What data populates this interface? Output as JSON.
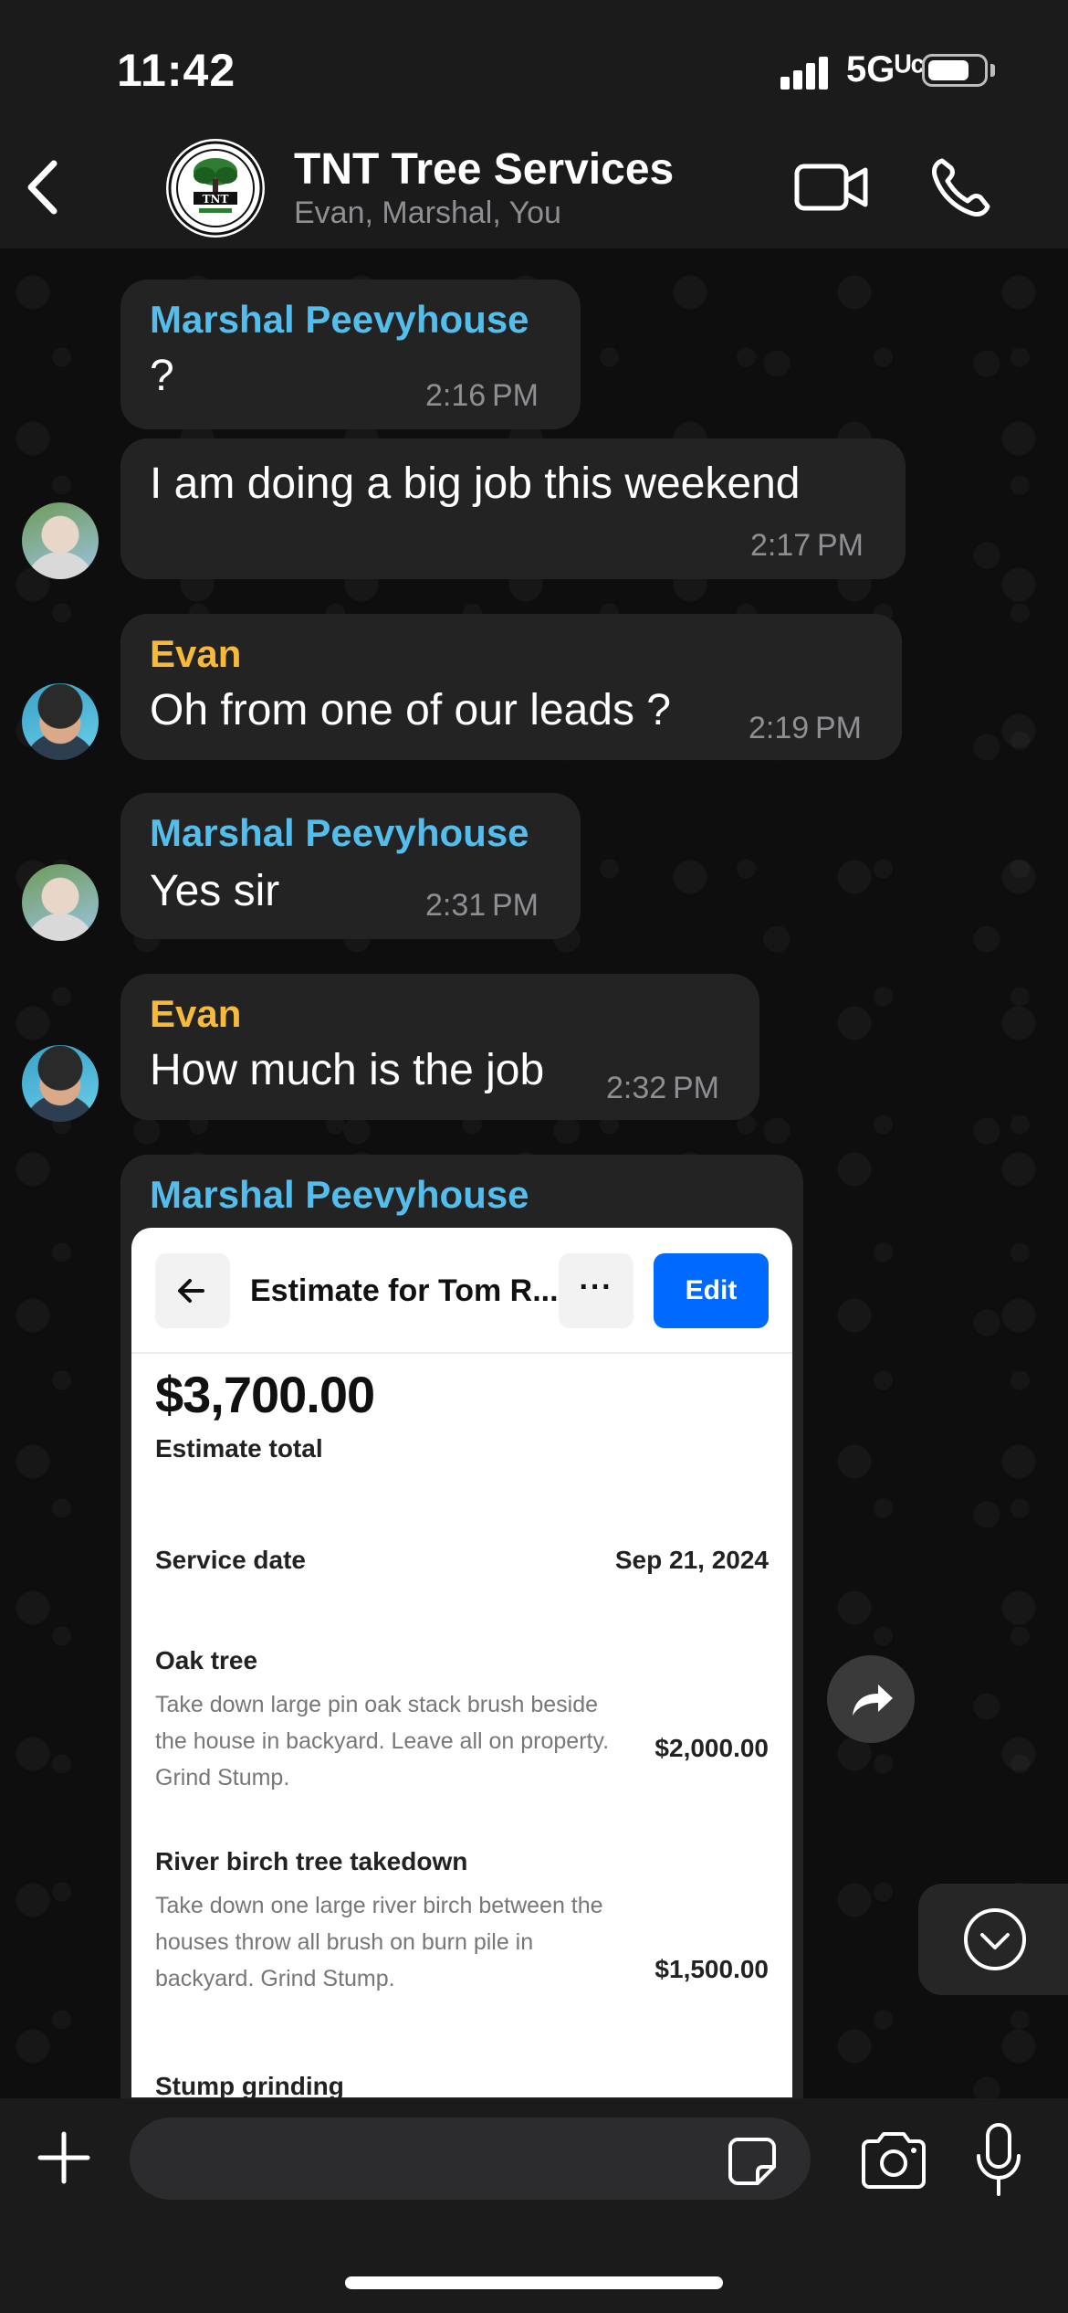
{
  "status_bar": {
    "time": "11:42",
    "network": "5Gᵁᶜ",
    "battery_level": 0.75
  },
  "header": {
    "back_icon": "chevron-left-icon",
    "title": "TNT Tree Services",
    "subtitle": "Evan, Marshal, You",
    "avatar_logo_text": "TNT",
    "video_icon": "video-camera-icon",
    "call_icon": "phone-icon"
  },
  "colors": {
    "marshal": "#53bdeb",
    "evan": "#f6b93b",
    "bubble": "#232323",
    "edit_button": "#006aff"
  },
  "messages": [
    {
      "sender": "Marshal Peevyhouse",
      "text": "?",
      "time": "2:16 PM"
    },
    {
      "sender": "",
      "text": "I am doing a big job this weekend",
      "time": "2:17 PM"
    },
    {
      "sender": "Evan",
      "text": "Oh from one of our leads ?",
      "time": "2:19 PM"
    },
    {
      "sender": "Marshal Peevyhouse",
      "text": "Yes sir",
      "time": "2:31 PM"
    },
    {
      "sender": "Evan",
      "text": "How much is the job",
      "time": "2:32 PM"
    },
    {
      "sender": "Marshal Peevyhouse",
      "text": "",
      "time": ""
    }
  ],
  "estimate": {
    "title": "Estimate for Tom R...",
    "more_label": "···",
    "edit_label": "Edit",
    "total": "$3,700.00",
    "total_label": "Estimate total",
    "service_date_label": "Service date",
    "service_date": "Sep 21, 2024",
    "items": [
      {
        "name": "Oak tree",
        "description": "Take down large pin oak stack brush beside the house in backyard. Leave all on property. Grind Stump.",
        "price": "$2,000.00"
      },
      {
        "name": "River birch tree takedown",
        "description": "Take down one large river birch between the houses throw all brush on burn pile in backyard. Grind Stump.",
        "price": "$1,500.00"
      },
      {
        "name": "Stump grinding",
        "description": "",
        "price": ""
      }
    ]
  },
  "input": {
    "placeholder": ""
  }
}
